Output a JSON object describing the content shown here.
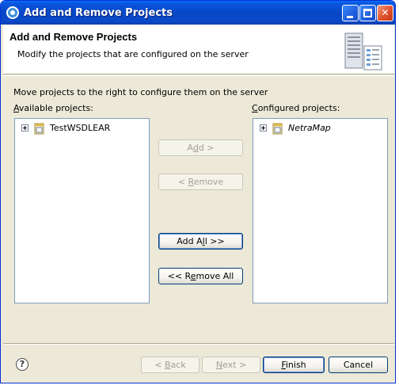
{
  "window": {
    "title": "Add and Remove Projects"
  },
  "header": {
    "title": "Add and Remove Projects",
    "description": "Modify the projects that are configured on the server"
  },
  "instruction": "Move projects to the right to configure them on the server",
  "available": {
    "label_underlined": "A",
    "label_rest": "vailable projects:",
    "items": [
      {
        "label": "TestWSDLEAR"
      }
    ]
  },
  "configured": {
    "label_underlined": "C",
    "label_rest": "onfigured projects:",
    "items": [
      {
        "label": "NetraMap"
      }
    ]
  },
  "buttons": {
    "add_pre": "A",
    "add_u": "d",
    "add_post": "d >",
    "remove_pre": "< ",
    "remove_u": "R",
    "remove_post": "emove",
    "addall_pre": "Add A",
    "addall_u": "l",
    "addall_post": "l >>",
    "removeall_pre": "<< R",
    "removeall_u": "e",
    "removeall_post": "move All",
    "back_pre": "< ",
    "back_u": "B",
    "back_post": "ack",
    "next_pre": "",
    "next_u": "N",
    "next_post": "ext >",
    "finish_pre": "",
    "finish_u": "F",
    "finish_post": "inish",
    "cancel": "Cancel"
  },
  "help_glyph": "?",
  "icons": [
    "app-icon",
    "minimize-icon",
    "maximize-icon",
    "close-icon",
    "server-icon",
    "expand-icon",
    "project-icon",
    "help-icon"
  ],
  "colors": {
    "titlebar": "#0747c6",
    "dialog_bg": "#ece9d8",
    "list_border": "#7f9db9",
    "disabled_text": "#a19f93"
  }
}
